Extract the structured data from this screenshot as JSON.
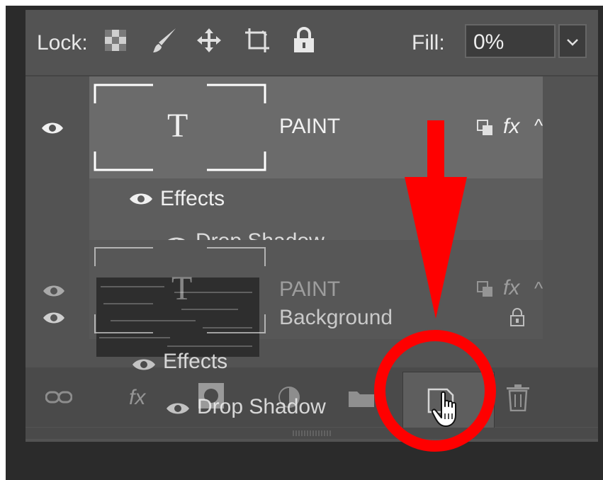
{
  "lock_bar": {
    "lock_label": "Lock:",
    "fill_label": "Fill:",
    "fill_value": "0%",
    "icons": [
      "checkerboard-icon",
      "brush-icon",
      "move-icon",
      "crop-icon",
      "padlock-icon"
    ]
  },
  "layers": {
    "top": {
      "name": "PAINT",
      "thumb_glyph": "T",
      "effects_label": "Effects",
      "drop_shadow_label": "Drop Shadow",
      "fx_label": "fx",
      "collapse_glyph": "^"
    },
    "ghost": {
      "name": "PAINT",
      "background_name": "Background",
      "effects_label": "Effects",
      "drop_shadow_label": "Drop Shadow",
      "fx_label": "fx",
      "collapse_glyph": "^"
    }
  },
  "footer": {
    "fx_label": "fx"
  },
  "annotation": {
    "arrow_color": "#ff0000",
    "circle_color": "#ff0000"
  }
}
